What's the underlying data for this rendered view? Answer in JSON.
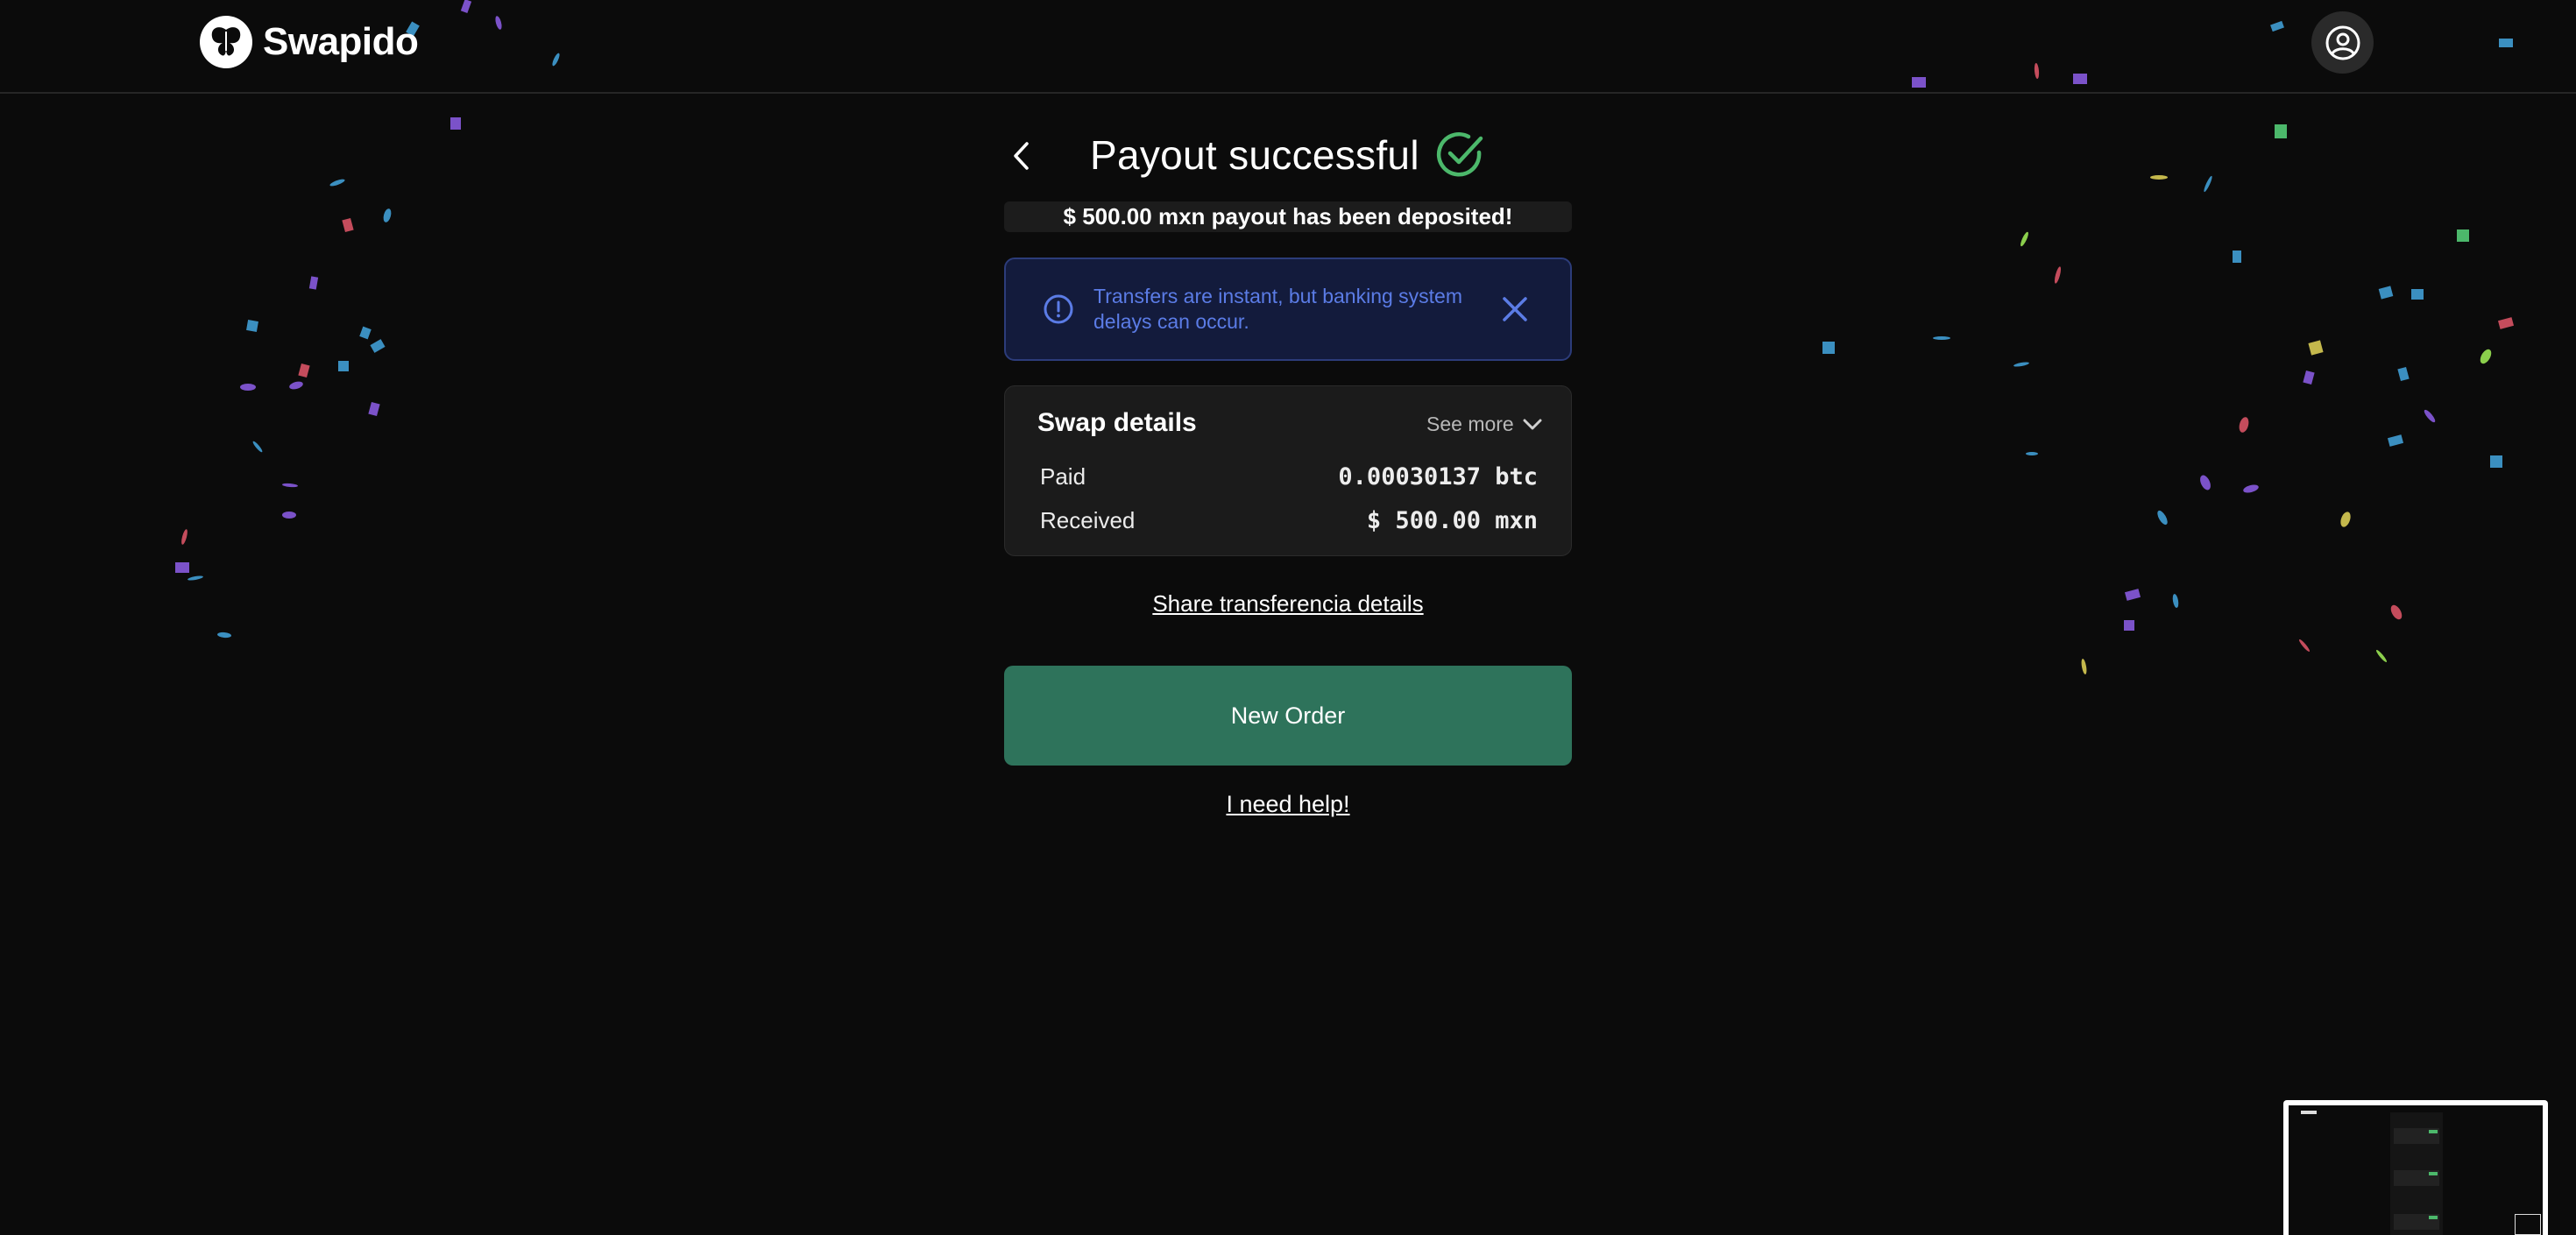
{
  "header": {
    "logo_text": "Swapido",
    "logo_icon": "butterfly-icon",
    "profile_icon": "user-circle-icon"
  },
  "main": {
    "back_icon": "chevron-left-icon",
    "title": "Payout successful",
    "title_icon": "check-circle-icon",
    "deposit_message": "$ 500.00 mxn payout has been deposited!",
    "info_alert": {
      "icon": "info-circle-icon",
      "text": "Transfers are instant, but banking system delays can occur.",
      "close_icon": "close-icon"
    },
    "swap_details": {
      "title": "Swap details",
      "see_more_label": "See more",
      "see_more_icon": "chevron-down-icon",
      "rows": [
        {
          "label": "Paid",
          "value": "0.00030137 btc"
        },
        {
          "label": "Received",
          "value": "$ 500.00 mxn"
        }
      ]
    },
    "share_link_label": "Share transferencia details",
    "new_order_label": "New Order",
    "help_link_label": "I need help!"
  },
  "colors": {
    "background": "#0b0b0b",
    "success_green": "#4cb86b",
    "button_green": "#2e735b",
    "info_blue": "#5b7ce6",
    "info_bg": "#131b3c"
  }
}
